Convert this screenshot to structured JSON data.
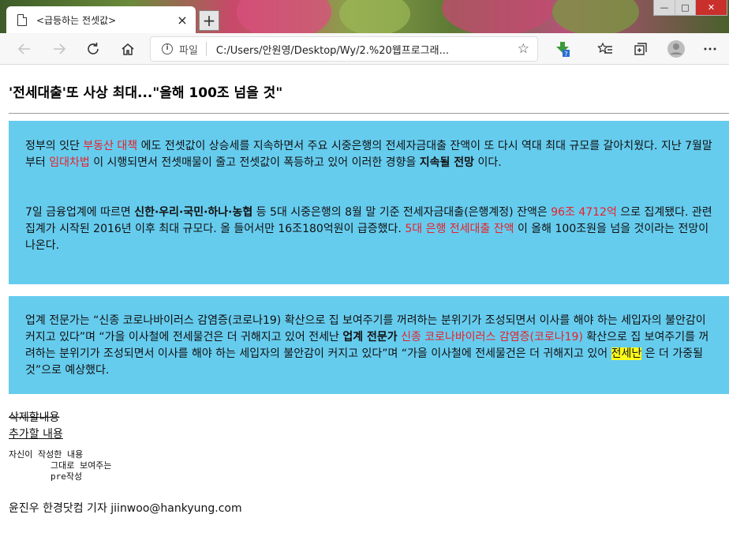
{
  "browser": {
    "tab_title": "<급등하는 전셋값>",
    "tab_close": "×",
    "new_tab": "+",
    "address_protocol": "파일",
    "address_url": "C:/Users/안원영/Desktop/Wy/2.%20웹프로그래...",
    "icons": [
      "back-arrow-icon",
      "forward-arrow-icon",
      "refresh-icon",
      "home-icon",
      "info-icon",
      "star-icon",
      "extension-icon",
      "favorites-icon",
      "collections-icon",
      "profile-icon",
      "more-icon"
    ]
  },
  "article": {
    "headline": "'전세대출'또 사상 최대...\"올해 100조 넘을 것\"",
    "box1": {
      "p1": {
        "t1": "정부의 잇단 ",
        "red1": "부동산 대책",
        "t2": " 에도 전셋값이 상승세를 지속하면서 주요 시중은행의 전세자금대출 잔액이 또 다시 역대 최대 규모를 갈아치웠다. 지난 7월말부터 ",
        "red2": "임대차법",
        "t3": " 이 시행되면서 전셋매물이 줄고 전셋값이 폭등하고 있어 이러한 경향을 ",
        "bold1": "지속될 전망",
        "t4": " 이다."
      },
      "p2": {
        "t1": "7일 금융업계에 따르면 ",
        "bold1": "신한·우리·국민·하나·농협",
        "t2": " 등 5대 시중은행의 8월 말 기준 전세자금대출(은행계정) 잔액은 ",
        "red1": "96조 4712억",
        "t3": " 으로 집계됐다. 관련 집계가 시작된 2016년 이후 최대 규모다. 올 들어서만 16조180억원이 급증했다. ",
        "red2": "5대 은행 전세대출 잔액",
        "t4": " 이 올해 100조원을 넘을 것이라는 전망이 나온다."
      }
    },
    "box2": {
      "t1": "업계 전문가는 “신종 코로나바이러스 감염증(코로나19) 확산으로 집 보여주기를 꺼려하는 분위기가 조성되면서 이사를 해야 하는 세입자의 불안감이 커지고 있다”며 “가을 이사철에 전세물건은 더 귀해지고 있어 전세난 ",
      "bold1": "업계 전문가",
      "t2": " ",
      "red1": "신종 코로나바이러스 감염증(코로나19)",
      "t3": " 확산으로 집 보여주기를 꺼려하는 분위기가 조성되면서 이사를 해야 하는 세입자의 불안감이 커지고 있다”며 “가을 이사철에 전세물건은 더 귀해지고 있어 ",
      "hl1": "전세난",
      "t4": " 은 더 가중될 것”으로 예상했다."
    },
    "deleted_text": "삭제할내용",
    "inserted_text": "추가할 내용",
    "pre_text": "자신이 작성한 내용\n        그대로 보여주는\n        pre작성",
    "byline": "윤진우 한경닷컴 기자 jiinwoo@hankyung.com"
  },
  "colors": {
    "box_bg": "#66ccee",
    "red_text": "#e8202a",
    "highlight": "#ffff1a"
  }
}
